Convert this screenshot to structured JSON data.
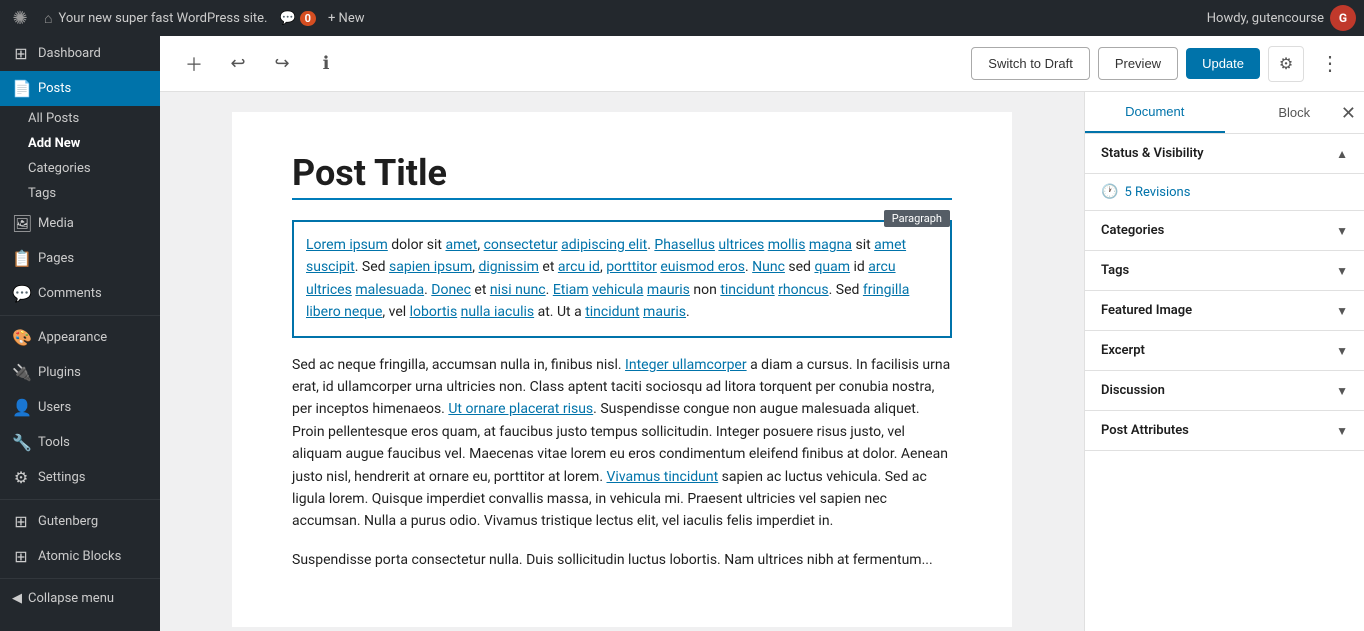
{
  "adminBar": {
    "logo": "✺",
    "siteName": "Your new super fast WordPress site.",
    "houseIcon": "⌂",
    "comments": "0",
    "newLabel": "+ New",
    "howdy": "Howdy, gutencourse",
    "avatarText": "G"
  },
  "sidebar": {
    "dashboardLabel": "Dashboard",
    "postsLabel": "Posts",
    "allPostsLabel": "All Posts",
    "addNewLabel": "Add New",
    "categoriesLabel": "Categories",
    "tagsLabel": "Tags",
    "mediaLabel": "Media",
    "pagesLabel": "Pages",
    "commentsLabel": "Comments",
    "appearanceLabel": "Appearance",
    "pluginsLabel": "Plugins",
    "usersLabel": "Users",
    "toolsLabel": "Tools",
    "settingsLabel": "Settings",
    "gutenbergLabel": "Gutenberg",
    "atomicBlocksLabel": "Atomic Blocks",
    "collapseMenuLabel": "Collapse menu"
  },
  "toolbar": {
    "undoTitle": "Undo",
    "redoTitle": "Redo",
    "infoTitle": "Info",
    "addBlockTitle": "Add Block",
    "switchToDraftLabel": "Switch to Draft",
    "previewLabel": "Preview",
    "updateLabel": "Update"
  },
  "editor": {
    "postTitle": "Post Title",
    "paragraphBlockLabel": "Paragraph",
    "paragraph1": "Lorem ipsum dolor sit amet, consectetur adipiscing elit. Phasellus ultrices mollis magna sit amet suscipit. Sed sapien ipsum, dignissim et arcu id, porttitor euismod eros. Nunc sed quam id arcu ultrices malesuada. Donec et nisi nunc. Etiam vehicula mauris non tincidunt rhoncus. Sed fringilla libero neque, vel lobortis nulla iaculis at. Ut a tincidunt mauris.",
    "paragraph2": "Sed ac neque fringilla, accumsan nulla in, finibus nisl. Integer ullamcorper a diam a cursus. In facilisis urna erat, id ullamcorper urna ultricies non. Class aptent taciti sociosqu ad litora torquent per conubia nostra, per inceptos himenaeos. Ut ornare placerat risus. Suspendisse congue non augue malesuada aliquet. Proin pellentesque eros quam, at faucibus justo tempus sollicitudin. Integer posuere risus justo, vel aliquam augue faucibus vel. Maecenas vitae lorem eu eros condimentum eleifend finibus at dolor. Aenean justo nisl, hendrerit at ornare eu, porttitor at lorem. Vivamus tincidunt sapien ac luctus vehicula. Sed ac ligula lorem. Quisque imperdiet convallis massa, in vehicula mi. Praesent ultricies vel sapien nec accumsan. Nulla a purus odio. Vivamus tristique lectus elit, vel iaculis felis imperdiet in.",
    "paragraph3": "Suspendisse porta consectetur nulla. Duis sollicitudin luctus lobortis. Nam ultrices nibh at fermentum..."
  },
  "settingsPanel": {
    "documentTabLabel": "Document",
    "blockTabLabel": "Block",
    "statusVisibilityLabel": "Status & Visibility",
    "revisionsLabel": "Revisions",
    "revisionsCount": "5 Revisions",
    "categoriesLabel": "Categories",
    "tagsLabel": "Tags",
    "featuredImageLabel": "Featured Image",
    "excerptLabel": "Excerpt",
    "discussionLabel": "Discussion",
    "postAttributesLabel": "Post Attributes"
  }
}
